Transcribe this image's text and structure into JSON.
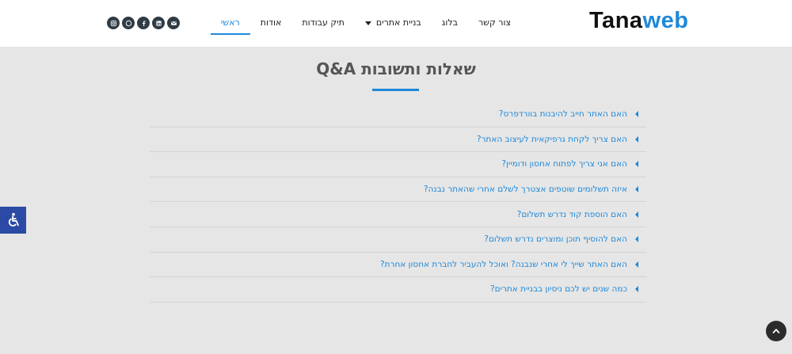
{
  "header": {
    "logo_part1": "Tana",
    "logo_part2": "web",
    "nav": [
      {
        "label": "ראשי",
        "active": true
      },
      {
        "label": "אודות"
      },
      {
        "label": "תיק עבודות"
      },
      {
        "label": "בניית אתרים",
        "has_dropdown": true
      },
      {
        "label": "בלוג"
      },
      {
        "label": "צור קשר"
      }
    ],
    "social_icons": [
      "instagram-icon",
      "whatsapp-icon",
      "facebook-icon",
      "linkedin-icon",
      "email-icon"
    ]
  },
  "main": {
    "title": "שאלות ותשובות Q&A",
    "faq": [
      "האם האתר חייב להיבנות בוורדפרס?",
      "האם צריך לקחת גרפיקאית לעיצוב האתר?",
      "האם אני צריך לפתוח אחסון ודומיין?",
      "איזה תשלומים שוטפים אצטרך לשלם אחרי שהאתר נבנה?",
      "האם הוספת קוד נדרש תשלום?",
      "האם להוסיף תוכן ומוצרים נדרש תשלום?",
      "האם האתר שייך לי אחרי שנבנה? ואוכל להעביר לחברת אחסון אחרת?",
      "כמה שנים יש לכם ניסיון בבניית אתרים?"
    ]
  },
  "colors": {
    "accent": "#1e88d8",
    "background": "#e6e6e6",
    "accessibility": "#2a4aa5"
  }
}
